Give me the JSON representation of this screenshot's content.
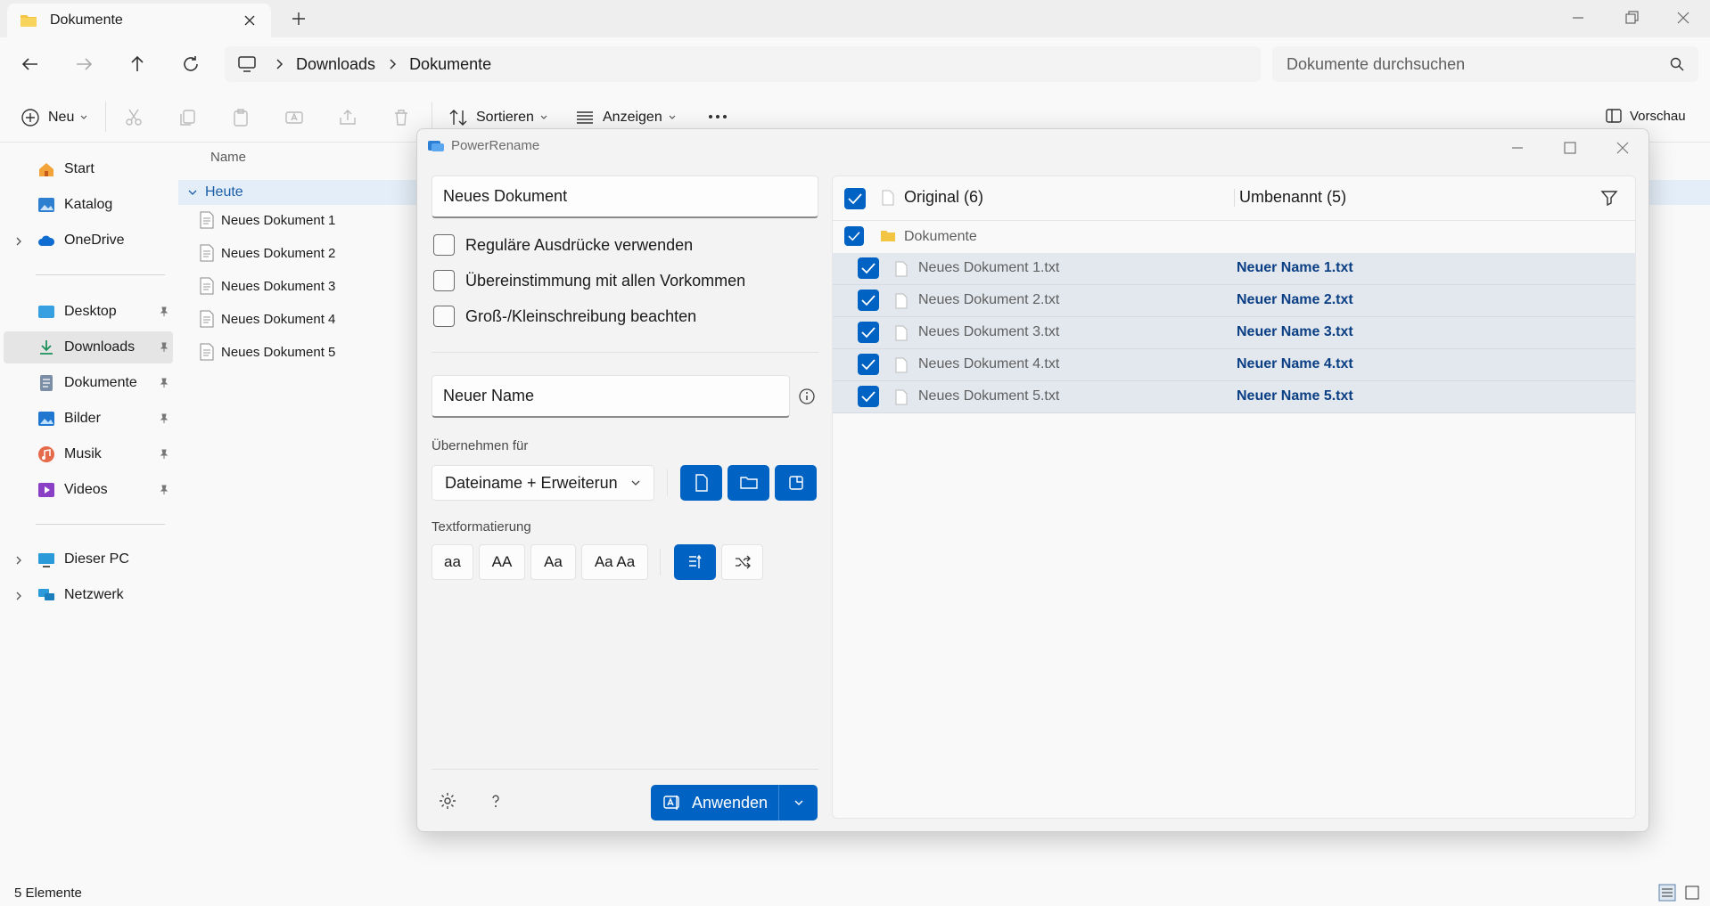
{
  "explorer": {
    "tab_title": "Dokumente",
    "breadcrumb": [
      "Downloads",
      "Dokumente"
    ],
    "search_placeholder": "Dokumente durchsuchen",
    "toolbar": {
      "new_label": "Neu",
      "sort_label": "Sortieren",
      "view_label": "Anzeigen",
      "preview_label": "Vorschau"
    },
    "sidebar": {
      "quick": [
        {
          "label": "Start",
          "icon": "home-icon"
        },
        {
          "label": "Katalog",
          "icon": "gallery-icon"
        },
        {
          "label": "OneDrive",
          "icon": "cloud-icon"
        }
      ],
      "pinned": [
        {
          "label": "Desktop",
          "icon": "desktop-icon"
        },
        {
          "label": "Downloads",
          "icon": "download-icon"
        },
        {
          "label": "Dokumente",
          "icon": "document-icon"
        },
        {
          "label": "Bilder",
          "icon": "pictures-icon"
        },
        {
          "label": "Musik",
          "icon": "music-icon"
        },
        {
          "label": "Videos",
          "icon": "videos-icon"
        }
      ],
      "devices": [
        {
          "label": "Dieser PC",
          "icon": "pc-icon"
        },
        {
          "label": "Netzwerk",
          "icon": "network-icon"
        }
      ]
    },
    "column_name": "Name",
    "group_label": "Heute",
    "files": [
      "Neues Dokument 1",
      "Neues Dokument 2",
      "Neues Dokument 3",
      "Neues Dokument 4",
      "Neues Dokument 5"
    ],
    "status": "5 Elemente"
  },
  "powerrename": {
    "title": "PowerRename",
    "search_value": "Neues Dokument",
    "options": [
      "Reguläre Ausdrücke verwenden",
      "Übereinstimmung mit allen Vorkommen",
      "Groß-/Kleinschreibung beachten"
    ],
    "replace_value": "Neuer Name",
    "apply_for_label": "Übernehmen für",
    "apply_for_value": "Dateiname + Erweiterun",
    "text_format_label": "Textformatierung",
    "case_buttons": [
      "aa",
      "AA",
      "Aa",
      "Aa Aa"
    ],
    "apply_label": "Anwenden",
    "preview": {
      "original_header": "Original (6)",
      "renamed_header": "Umbenannt (5)",
      "folder": "Dokumente",
      "rows": [
        {
          "original": "Neues Dokument 1.txt",
          "renamed": "Neuer Name 1.txt"
        },
        {
          "original": "Neues Dokument 2.txt",
          "renamed": "Neuer Name 2.txt"
        },
        {
          "original": "Neues Dokument 3.txt",
          "renamed": "Neuer Name 3.txt"
        },
        {
          "original": "Neues Dokument 4.txt",
          "renamed": "Neuer Name 4.txt"
        },
        {
          "original": "Neues Dokument 5.txt",
          "renamed": "Neuer Name 5.txt"
        }
      ]
    }
  },
  "colors": {
    "accent": "#0062c3",
    "renamed_text": "#0b3f84",
    "selection": "#e3e8ef"
  }
}
